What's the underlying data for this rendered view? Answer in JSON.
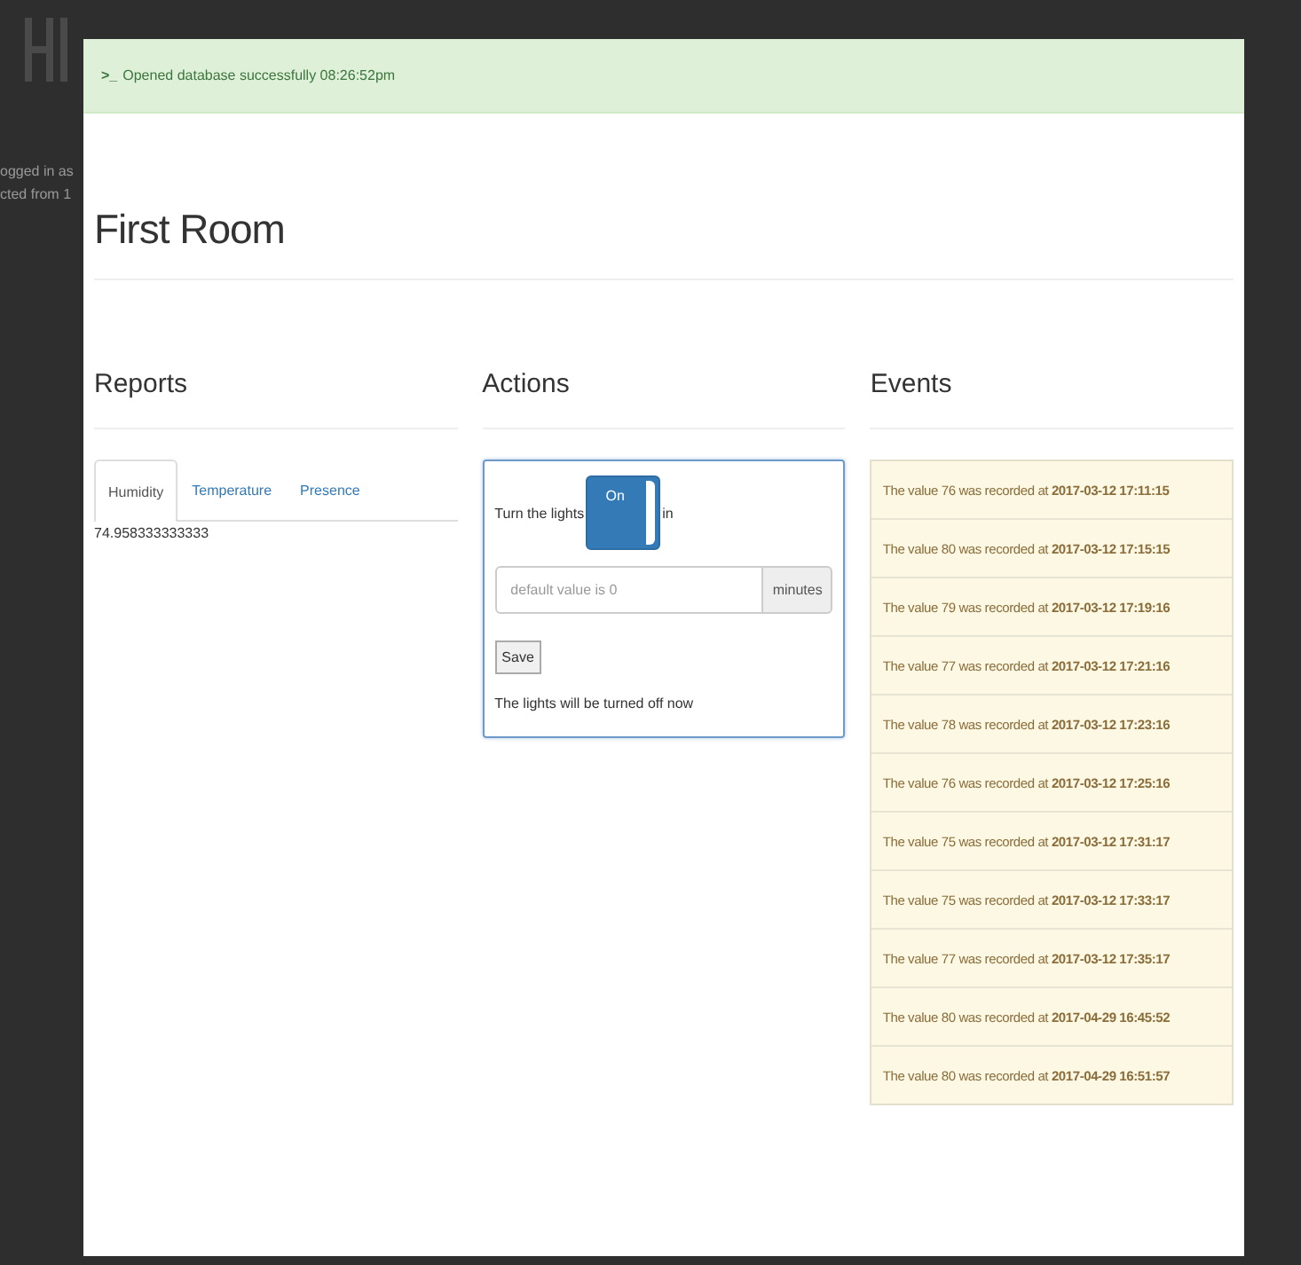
{
  "background": {
    "texts": [
      "ogged in as",
      "cted from 1"
    ]
  },
  "alert": {
    "icon": ">_",
    "message": "Opened database successfully 08:26:52pm"
  },
  "title": "First Room",
  "reports": {
    "heading": "Reports",
    "tabs": [
      {
        "label": "Humidity",
        "selected": true
      },
      {
        "label": "Temperature",
        "selected": false
      },
      {
        "label": "Presence",
        "selected": false
      }
    ],
    "value": "74.958333333333"
  },
  "actions": {
    "heading": "Actions",
    "label_before": "Turn the lights",
    "toggle": {
      "label": "On",
      "on": true
    },
    "label_after": "in",
    "input": {
      "placeholder": "default value is 0",
      "addon": "minutes"
    },
    "button": "Save",
    "status": "The lights will be turned off now"
  },
  "events": {
    "heading": "Events",
    "items": [
      "The value 76 was recorded at **2017-03-12 17:11:15**",
      "The value 80 was recorded at **2017-03-12 17:15:15**",
      "The value 79 was recorded at **2017-03-12 17:19:16**",
      "The value 77 was recorded at **2017-03-12 17:21:16**",
      "The value 78 was recorded at **2017-03-12 17:23:16**",
      "The value 76 was recorded at **2017-03-12 17:25:16**",
      "The value 75 was recorded at **2017-03-12 17:31:17**",
      "The value 75 was recorded at **2017-03-12 17:33:17**",
      "The value 77 was recorded at **2017-03-12 17:35:17**",
      "The value 80 was recorded at **2017-04-29 16:45:52**",
      "The value 80 was recorded at **2017-04-29 16:51:57**"
    ]
  }
}
